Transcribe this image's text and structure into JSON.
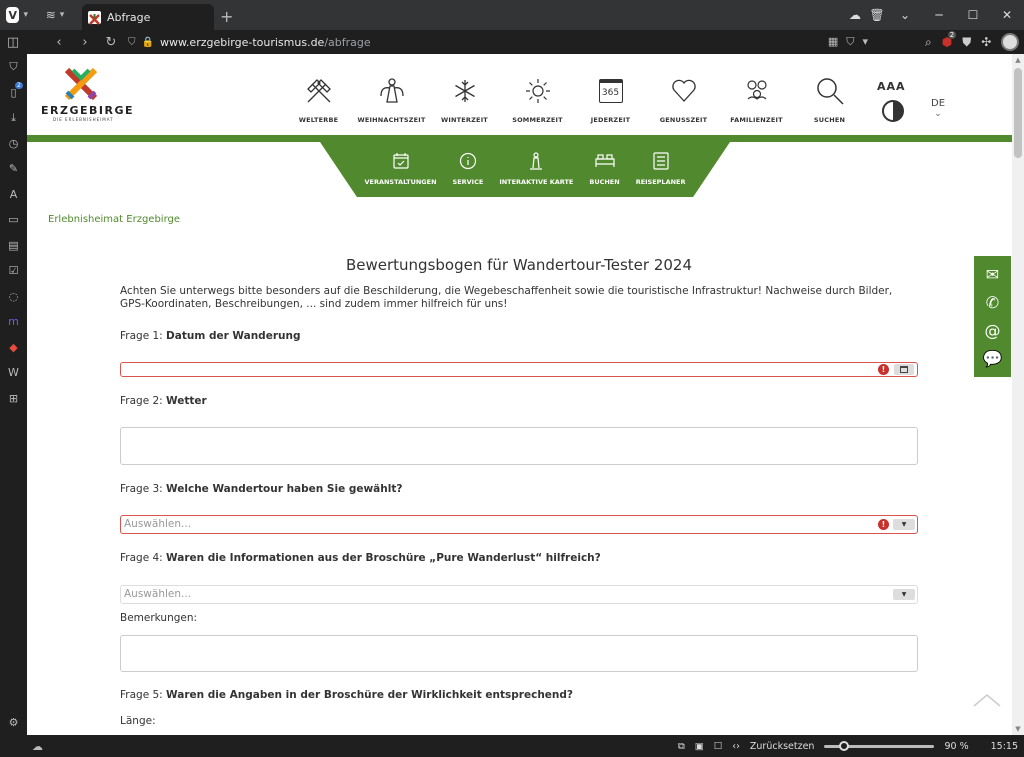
{
  "browser": {
    "tab_title": "Abfrage",
    "url_domain": "www.erzgebirge-tourismus.de",
    "url_path": "/abfrage",
    "vivaldi_letter": "V",
    "extension_badge": "2",
    "sidebar_badge": "2"
  },
  "site": {
    "logo_name": "ERZGEBIRGE",
    "logo_tag": "DIE ERLEBNISHEIMAT",
    "topnav": [
      {
        "label": "WELTERBE",
        "icon": "hammer-pick-icon"
      },
      {
        "label": "WEIHNACHTSZEIT",
        "icon": "angel-icon"
      },
      {
        "label": "WINTERZEIT",
        "icon": "snowflake-icon"
      },
      {
        "label": "SOMMERZEIT",
        "icon": "sun-icon"
      },
      {
        "label": "JEDERZEIT",
        "icon": "calendar-365-icon"
      },
      {
        "label": "GENUSSZEIT",
        "icon": "heart-icon"
      },
      {
        "label": "FAMILIENZEIT",
        "icon": "family-icon"
      },
      {
        "label": "SUCHEN",
        "icon": "search-icon"
      }
    ],
    "calendar_number": "365",
    "font_size_label": "AAA",
    "language": "DE",
    "subnav": [
      {
        "label": "VERANSTALTUNGEN"
      },
      {
        "label": "SERVICE"
      },
      {
        "label": "INTERAKTIVE KARTE"
      },
      {
        "label": "BUCHEN"
      },
      {
        "label": "REISEPLANER"
      }
    ]
  },
  "content": {
    "breadcrumb": "Erlebnisheimat Erzgebirge",
    "title": "Bewertungsbogen für Wandertour-Tester 2024",
    "intro": "Achten Sie unterwegs bitte besonders auf die Beschilderung, die Wegebeschaffenheit sowie die touristische Infrastruktur! Nachweise durch Bilder, GPS-Koordinaten, Beschreibungen, ... sind zudem immer hilfreich für uns!",
    "q1_prefix": "Frage 1: ",
    "q1_text": "Datum der Wanderung",
    "q2_prefix": "Frage 2: ",
    "q2_text": "Wetter",
    "q3_prefix": "Frage 3: ",
    "q3_text": "Welche Wandertour haben Sie gewählt?",
    "q3_placeholder": "Auswählen...",
    "q4_prefix": "Frage 4: ",
    "q4_text": "Waren die Informationen aus der Broschüre „Pure Wanderlust“ hilfreich?",
    "q4_placeholder": "Auswählen...",
    "remarks_label": "Bemerkungen:",
    "q5_prefix": "Frage 5: ",
    "q5_text": "Waren die Angaben in der Broschüre der Wirklichkeit entsprechend?",
    "length_label": "Länge:",
    "error_mark": "!"
  },
  "statusbar": {
    "reset_label": "Zurücksetzen",
    "zoom": "90 %",
    "zoom_fraction": 0.18,
    "time": "15:15"
  }
}
